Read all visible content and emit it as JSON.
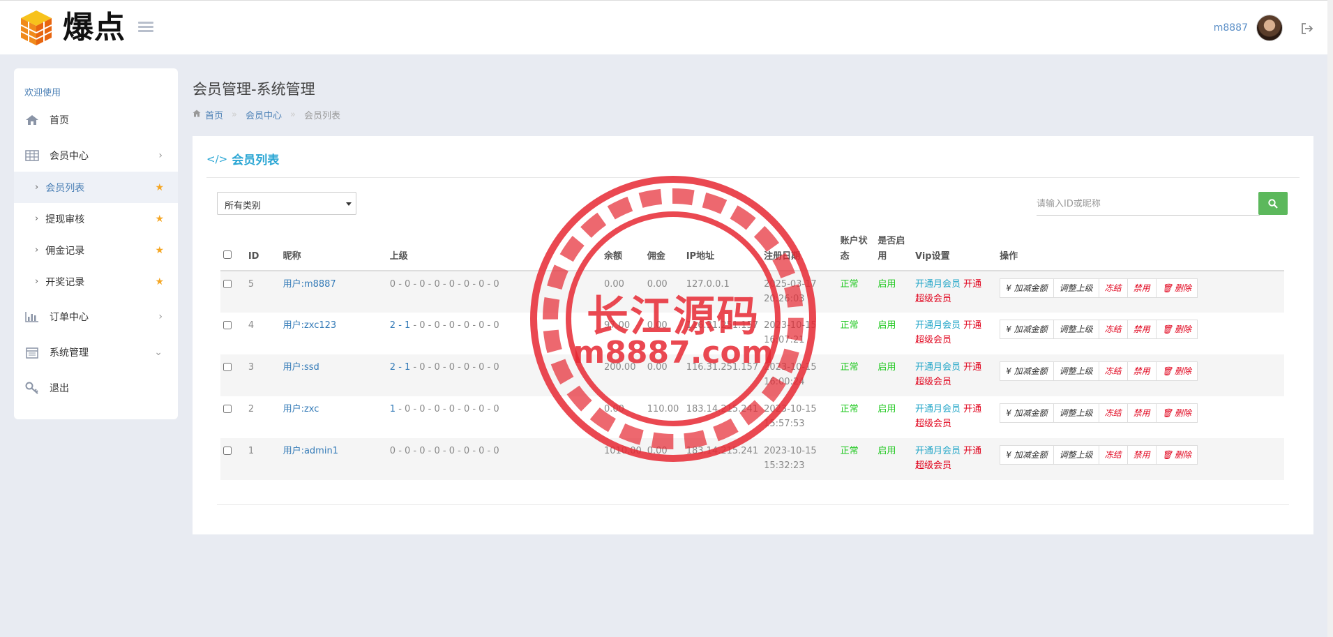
{
  "header": {
    "logo_text": "爆点",
    "username": "m8887",
    "menu_icon": "list-icon",
    "logout_icon": "logout-icon"
  },
  "sidebar": {
    "welcome": "欢迎使用",
    "items": [
      {
        "label": "首页",
        "icon": "home-icon"
      },
      {
        "label": "会员中心",
        "icon": "table-icon"
      },
      {
        "label": "订单中心",
        "icon": "bar-chart-icon"
      },
      {
        "label": "系统管理",
        "icon": "calendar-icon"
      },
      {
        "label": "退出",
        "icon": "key-icon"
      }
    ],
    "subitems": [
      {
        "label": "会员列表"
      },
      {
        "label": "提现审核"
      },
      {
        "label": "佣金记录"
      },
      {
        "label": "开奖记录"
      }
    ]
  },
  "page": {
    "title": "会员管理-系统管理",
    "breadcrumb": [
      "首页",
      "会员中心",
      "会员列表"
    ]
  },
  "panel": {
    "title": "会员列表",
    "filter_selected": "所有类别",
    "search_placeholder": "请输入ID或昵称"
  },
  "table": {
    "headers": {
      "id": "ID",
      "nickname": "昵称",
      "parent": "上级",
      "balance": "余额",
      "commission": "佣金",
      "ip": "IP地址",
      "reg_date": "注册日期",
      "status": "账户状态",
      "enabled": "是否启用",
      "vip": "Vip设置",
      "ops": "操作"
    },
    "rows": [
      {
        "id": "5",
        "nickname": "用户:m8887",
        "parent_link": "",
        "parent_rest": "0 - 0 - 0 - 0 - 0 - 0 - 0 - 0",
        "balance": "0.00",
        "commission": "0.00",
        "ip": "127.0.0.1",
        "date": "2025-03-17",
        "time": "20:26:03",
        "status": "正常",
        "enabled": "启用",
        "vip_month": "开通月会员",
        "vip_open": "开通",
        "vip_super": "超级会员"
      },
      {
        "id": "4",
        "nickname": "用户:zxc123",
        "parent_link": "2 - 1",
        "parent_rest": " - 0 - 0 - 0 - 0 - 0 - 0",
        "balance": "97.00",
        "commission": "0.00",
        "ip": "116.31.251.157",
        "date": "2023-10-15",
        "time": "16:07:21",
        "status": "正常",
        "enabled": "启用",
        "vip_month": "开通月会员",
        "vip_open": "开通",
        "vip_super": "超级会员"
      },
      {
        "id": "3",
        "nickname": "用户:ssd",
        "parent_link": "2 - 1",
        "parent_rest": " - 0 - 0 - 0 - 0 - 0 - 0",
        "balance": "200.00",
        "commission": "0.00",
        "ip": "116.31.251.157",
        "date": "2023-10-15",
        "time": "16:00:24",
        "status": "正常",
        "enabled": "启用",
        "vip_month": "开通月会员",
        "vip_open": "开通",
        "vip_super": "超级会员"
      },
      {
        "id": "2",
        "nickname": "用户:zxc",
        "parent_link": "1",
        "parent_rest": " - 0 - 0 - 0 - 0 - 0 - 0 - 0",
        "balance": "0.00",
        "commission": "110.00",
        "ip": "183.14.215.241",
        "date": "2023-10-15",
        "time": "15:57:53",
        "status": "正常",
        "enabled": "启用",
        "vip_month": "开通月会员",
        "vip_open": "开通",
        "vip_super": "超级会员"
      },
      {
        "id": "1",
        "nickname": "用户:admin1",
        "parent_link": "",
        "parent_rest": "0 - 0 - 0 - 0 - 0 - 0 - 0 - 0",
        "balance": "1010.00",
        "commission": "0.00",
        "ip": "183.14.215.241",
        "date": "2023-10-15",
        "time": "15:32:23",
        "status": "正常",
        "enabled": "启用",
        "vip_month": "开通月会员",
        "vip_open": "开通",
        "vip_super": "超级会员"
      }
    ],
    "ops": [
      "¥ 加减金额",
      "调整上级",
      "冻结",
      "禁用",
      "删除"
    ]
  },
  "watermark": {
    "line1": "长江源码",
    "line2": "m8887.com"
  },
  "colors": {
    "accent": "#2aa6d4",
    "link": "#337ab7",
    "status_green": "#1ec81e",
    "danger_red": "#e0001a",
    "star_orange": "#f5a623",
    "search_green": "#5cb85c"
  }
}
